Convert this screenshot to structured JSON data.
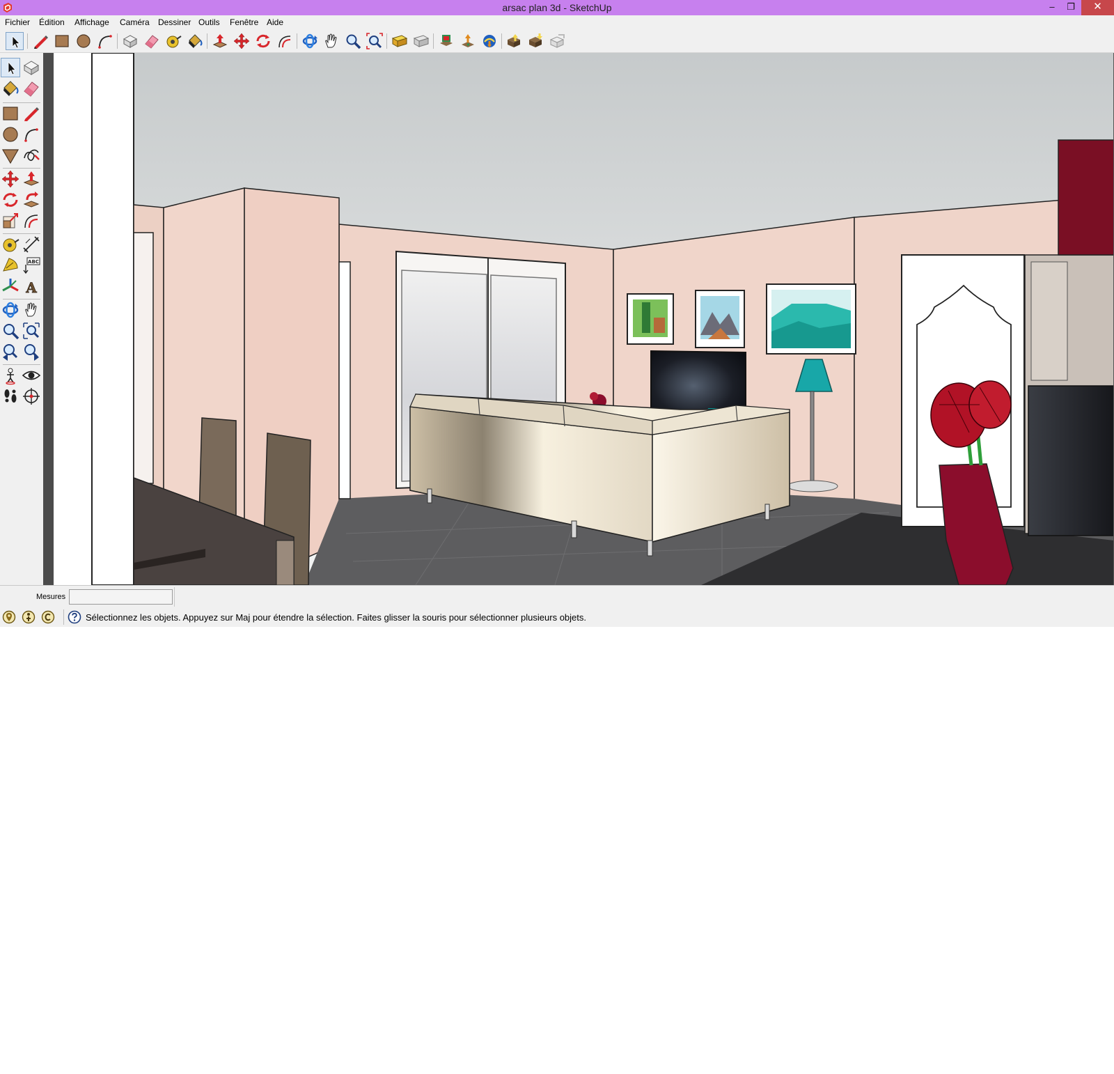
{
  "window": {
    "title": "arsac plan 3d - SketchUp",
    "minimize_glyph": "–",
    "restore_glyph": "❐",
    "close_glyph": "✕"
  },
  "menu": {
    "items": [
      {
        "label": "Fichier"
      },
      {
        "label": "Édition"
      },
      {
        "label": "Affichage"
      },
      {
        "label": "Caméra"
      },
      {
        "label": "Dessiner"
      },
      {
        "label": "Outils"
      },
      {
        "label": "Fenêtre"
      },
      {
        "label": "Aide"
      }
    ]
  },
  "toolbar_top": {
    "tools": [
      {
        "name": "select",
        "icon": "arrow-cursor-icon",
        "active": true
      },
      {
        "name": "line",
        "icon": "pencil-icon"
      },
      {
        "name": "rectangle",
        "icon": "rectangle-icon"
      },
      {
        "name": "circle",
        "icon": "circle-icon"
      },
      {
        "name": "arc",
        "icon": "arc-icon"
      },
      {
        "name": "make-component",
        "icon": "component-icon"
      },
      {
        "name": "eraser",
        "icon": "eraser-icon"
      },
      {
        "name": "tape-measure",
        "icon": "tape-measure-icon"
      },
      {
        "name": "paint-bucket",
        "icon": "paint-bucket-icon"
      },
      {
        "name": "push-pull",
        "icon": "push-pull-icon"
      },
      {
        "name": "move",
        "icon": "move-icon"
      },
      {
        "name": "rotate",
        "icon": "rotate-icon"
      },
      {
        "name": "offset",
        "icon": "offset-icon"
      },
      {
        "name": "orbit",
        "icon": "orbit-icon"
      },
      {
        "name": "pan",
        "icon": "hand-icon"
      },
      {
        "name": "zoom",
        "icon": "magnifier-icon"
      },
      {
        "name": "zoom-extents",
        "icon": "zoom-extents-icon"
      },
      {
        "name": "add-location",
        "icon": "add-location-icon"
      },
      {
        "name": "toggle-terrain",
        "icon": "terrain-icon"
      },
      {
        "name": "3d-warehouse",
        "icon": "warehouse-icon"
      },
      {
        "name": "share-model",
        "icon": "share-model-icon"
      },
      {
        "name": "get-models",
        "icon": "globe-icon"
      },
      {
        "name": "share-component",
        "icon": "share-component-icon"
      },
      {
        "name": "get-component",
        "icon": "get-component-icon"
      },
      {
        "name": "extension-warehouse",
        "icon": "extension-icon"
      }
    ]
  },
  "toolbar_left": {
    "tools": [
      {
        "name": "select",
        "icon": "arrow-cursor-icon",
        "active": true
      },
      {
        "name": "make-component",
        "icon": "component-icon"
      },
      {
        "name": "paint-bucket",
        "icon": "paint-bucket-icon"
      },
      {
        "name": "eraser",
        "icon": "eraser-icon"
      },
      {
        "name": "rectangle",
        "icon": "rectangle-icon"
      },
      {
        "name": "line",
        "icon": "pencil-icon"
      },
      {
        "name": "circle",
        "icon": "circle-icon"
      },
      {
        "name": "arc",
        "icon": "arc-icon"
      },
      {
        "name": "polygon",
        "icon": "polygon-icon"
      },
      {
        "name": "freehand",
        "icon": "freehand-icon"
      },
      {
        "name": "move",
        "icon": "move-icon"
      },
      {
        "name": "push-pull",
        "icon": "push-pull-icon"
      },
      {
        "name": "rotate",
        "icon": "rotate-icon"
      },
      {
        "name": "follow-me",
        "icon": "follow-me-icon"
      },
      {
        "name": "scale",
        "icon": "scale-icon"
      },
      {
        "name": "offset",
        "icon": "offset-icon"
      },
      {
        "name": "tape-measure",
        "icon": "tape-measure-icon"
      },
      {
        "name": "dimensions",
        "icon": "dimensions-icon"
      },
      {
        "name": "protractor",
        "icon": "protractor-icon"
      },
      {
        "name": "text",
        "icon": "text-label-icon",
        "label": "ABC"
      },
      {
        "name": "axes",
        "icon": "axes-icon"
      },
      {
        "name": "3d-text",
        "icon": "3d-text-icon",
        "label": "A"
      },
      {
        "name": "orbit",
        "icon": "orbit-icon"
      },
      {
        "name": "pan",
        "icon": "hand-icon"
      },
      {
        "name": "zoom",
        "icon": "magnifier-icon"
      },
      {
        "name": "zoom-window",
        "icon": "zoom-window-icon"
      },
      {
        "name": "previous-view",
        "icon": "previous-view-icon"
      },
      {
        "name": "next-view",
        "icon": "next-view-icon"
      },
      {
        "name": "position-camera",
        "icon": "position-camera-icon"
      },
      {
        "name": "look-around",
        "icon": "eye-icon"
      },
      {
        "name": "walk",
        "icon": "footprints-icon"
      },
      {
        "name": "section-plane",
        "icon": "section-plane-icon"
      }
    ]
  },
  "viewport": {
    "scene": "3d-living-room-model",
    "colors": {
      "sky_top": "#c6cacb",
      "sky_bottom": "#f3f4f4",
      "wall": "#efd5ca",
      "floor": "#5d5d5f",
      "sofa": "#e6dccb",
      "accent_red": "#8b0d2c",
      "lamp_shade": "#18a7a8"
    }
  },
  "measurements": {
    "label": "Mesures",
    "value": ""
  },
  "status": {
    "icons": [
      "geo-location-icon",
      "credits-icon",
      "copyright-icon"
    ],
    "help_icon": "help-icon",
    "message": "Sélectionnez les objets. Appuyez sur Maj pour étendre la sélection. Faites glisser la souris pour sélectionner plusieurs objets."
  }
}
